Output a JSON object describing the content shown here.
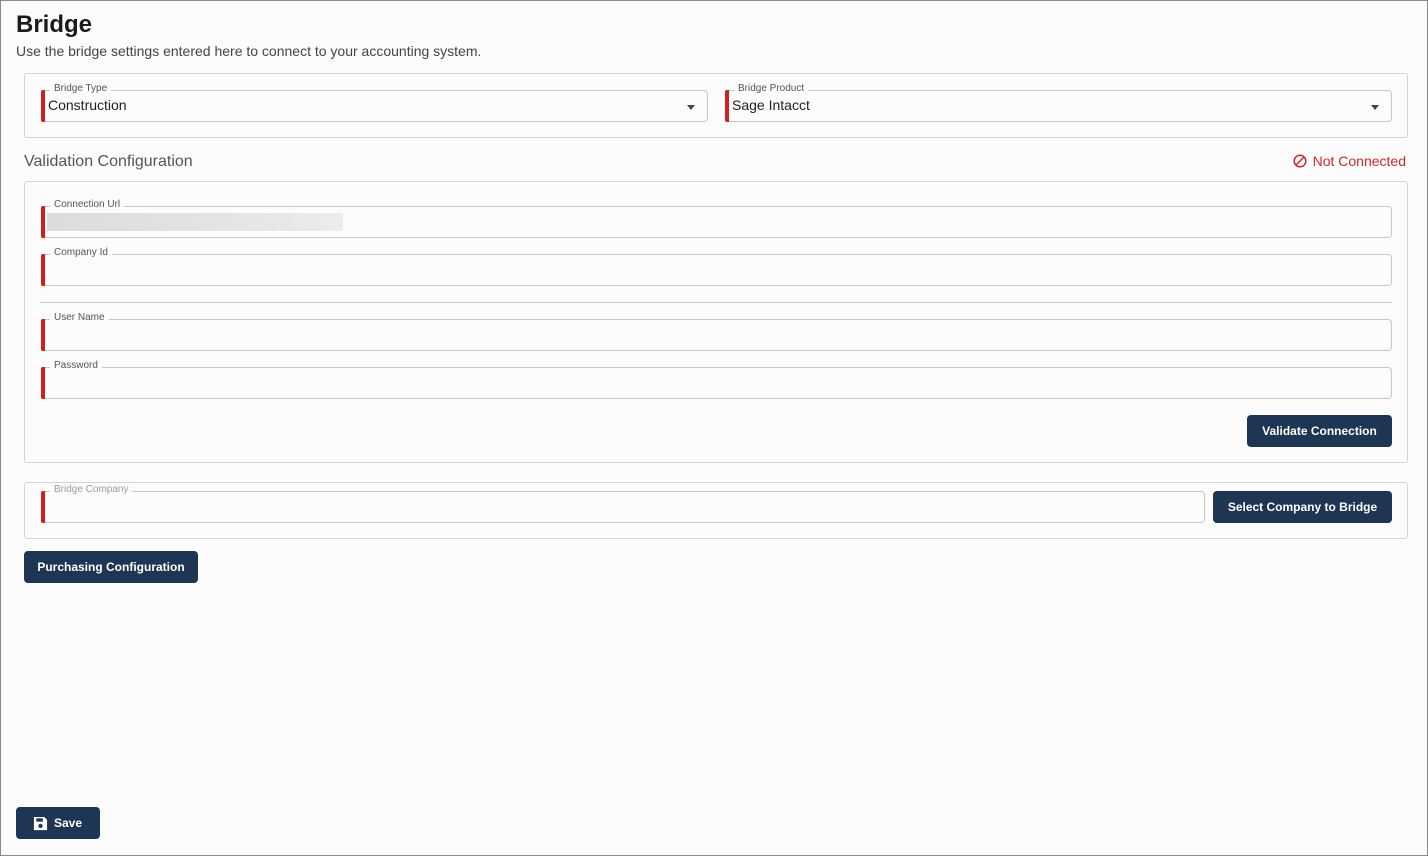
{
  "page": {
    "title": "Bridge",
    "subtitle": "Use the bridge settings entered here to connect to your accounting system."
  },
  "bridge_settings": {
    "bridge_type": {
      "label": "Bridge Type",
      "value": "Construction"
    },
    "bridge_product": {
      "label": "Bridge Product",
      "value": "Sage Intacct"
    }
  },
  "validation": {
    "title": "Validation Configuration",
    "status_text": "Not Connected",
    "status_color": "#cc2a2a",
    "fields": {
      "connection_url": {
        "label": "Connection Url",
        "value": ""
      },
      "company_id": {
        "label": "Company Id",
        "value": ""
      },
      "user_name": {
        "label": "User Name",
        "value": ""
      },
      "password": {
        "label": "Password",
        "value": ""
      }
    },
    "validate_button": "Validate Connection"
  },
  "bridge_company": {
    "label": "Bridge Company",
    "value": "",
    "select_button": "Select Company to Bridge"
  },
  "purchasing_button": "Purchasing Configuration",
  "save_button": "Save",
  "colors": {
    "primary_button": "#1e3554",
    "required_marker": "#d0201c",
    "not_connected": "#cc2a2a"
  },
  "icons": {
    "status": "ban-icon",
    "save": "floppy-disk-icon",
    "dropdown": "caret-down-icon"
  }
}
